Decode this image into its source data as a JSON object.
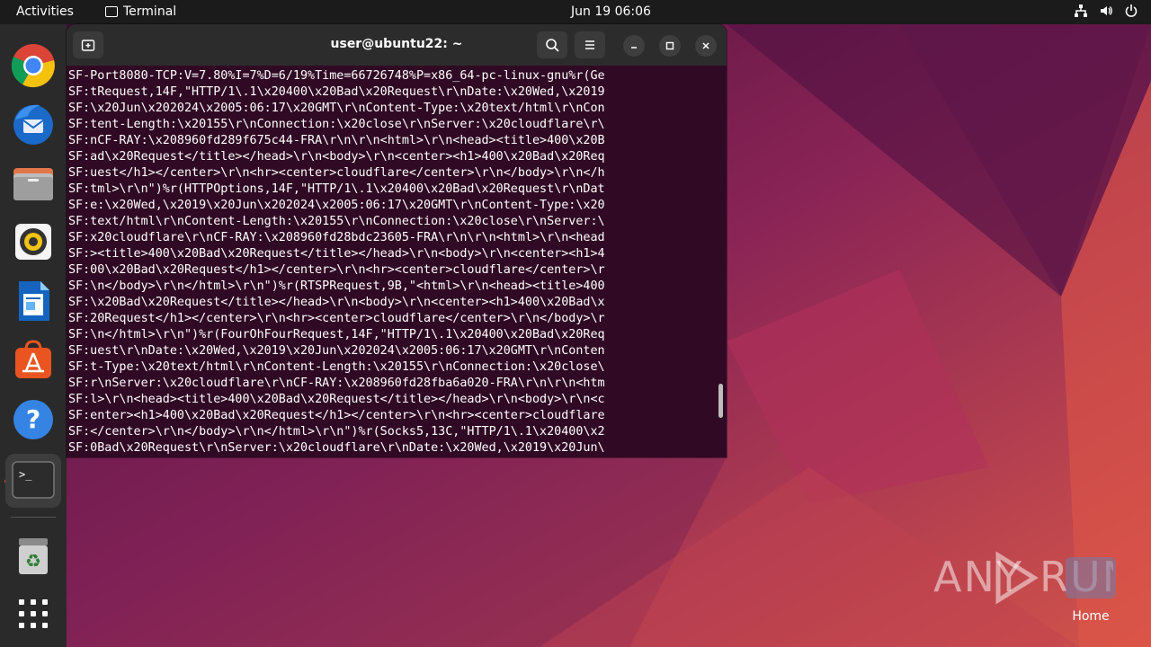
{
  "topbar": {
    "activities": "Activities",
    "app_name": "Terminal",
    "clock": "Jun 19  06:06"
  },
  "terminal": {
    "title": "user@ubuntu22: ~",
    "lines": [
      "SF-Port8080-TCP:V=7.80%I=7%D=6/19%Time=66726748%P=x86_64-pc-linux-gnu%r(Ge",
      "SF:tRequest,14F,\"HTTP/1\\.1\\x20400\\x20Bad\\x20Request\\r\\nDate:\\x20Wed,\\x2019",
      "SF:\\x20Jun\\x202024\\x2005:06:17\\x20GMT\\r\\nContent-Type:\\x20text/html\\r\\nCon",
      "SF:tent-Length:\\x20155\\r\\nConnection:\\x20close\\r\\nServer:\\x20cloudflare\\r\\",
      "SF:nCF-RAY:\\x208960fd289f675c44-FRA\\r\\n\\r\\n<html>\\r\\n<head><title>400\\x20B",
      "SF:ad\\x20Request</title></head>\\r\\n<body>\\r\\n<center><h1>400\\x20Bad\\x20Req",
      "SF:uest</h1></center>\\r\\n<hr><center>cloudflare</center>\\r\\n</body>\\r\\n</h",
      "SF:tml>\\r\\n\")%r(HTTPOptions,14F,\"HTTP/1\\.1\\x20400\\x20Bad\\x20Request\\r\\nDat",
      "SF:e:\\x20Wed,\\x2019\\x20Jun\\x202024\\x2005:06:17\\x20GMT\\r\\nContent-Type:\\x20",
      "SF:text/html\\r\\nContent-Length:\\x20155\\r\\nConnection:\\x20close\\r\\nServer:\\",
      "SF:x20cloudflare\\r\\nCF-RAY:\\x208960fd28bdc23605-FRA\\r\\n\\r\\n<html>\\r\\n<head",
      "SF:><title>400\\x20Bad\\x20Request</title></head>\\r\\n<body>\\r\\n<center><h1>4",
      "SF:00\\x20Bad\\x20Request</h1></center>\\r\\n<hr><center>cloudflare</center>\\r",
      "SF:\\n</body>\\r\\n</html>\\r\\n\")%r(RTSPRequest,9B,\"<html>\\r\\n<head><title>400",
      "SF:\\x20Bad\\x20Request</title></head>\\r\\n<body>\\r\\n<center><h1>400\\x20Bad\\x",
      "SF:20Request</h1></center>\\r\\n<hr><center>cloudflare</center>\\r\\n</body>\\r",
      "SF:\\n</html>\\r\\n\")%r(FourOhFourRequest,14F,\"HTTP/1\\.1\\x20400\\x20Bad\\x20Req",
      "SF:uest\\r\\nDate:\\x20Wed,\\x2019\\x20Jun\\x202024\\x2005:06:17\\x20GMT\\r\\nConten",
      "SF:t-Type:\\x20text/html\\r\\nContent-Length:\\x20155\\r\\nConnection:\\x20close\\",
      "SF:r\\nServer:\\x20cloudflare\\r\\nCF-RAY:\\x208960fd28fba6a020-FRA\\r\\n\\r\\n<htm",
      "SF:l>\\r\\n<head><title>400\\x20Bad\\x20Request</title></head>\\r\\n<body>\\r\\n<c",
      "SF:enter><h1>400\\x20Bad\\x20Request</h1></center>\\r\\n<hr><center>cloudflare",
      "SF:</center>\\r\\n</body>\\r\\n</html>\\r\\n\")%r(Socks5,13C,\"HTTP/1\\.1\\x20400\\x2",
      "SF:0Bad\\x20Request\\r\\nServer:\\x20cloudflare\\r\\nDate:\\x20Wed,\\x2019\\x20Jun\\"
    ]
  },
  "desktop": {
    "home_label": "Home",
    "watermark": "ANY RUN"
  },
  "dock": {
    "items": [
      "chrome-icon",
      "thunderbird-icon",
      "files-icon",
      "rhythmbox-icon",
      "writer-icon",
      "app-center-icon",
      "help-icon",
      "terminal-icon",
      "trash-icon",
      "show-apps-icon"
    ]
  },
  "colors": {
    "terminal_bg": "#300a24",
    "accent": "#e95420"
  }
}
